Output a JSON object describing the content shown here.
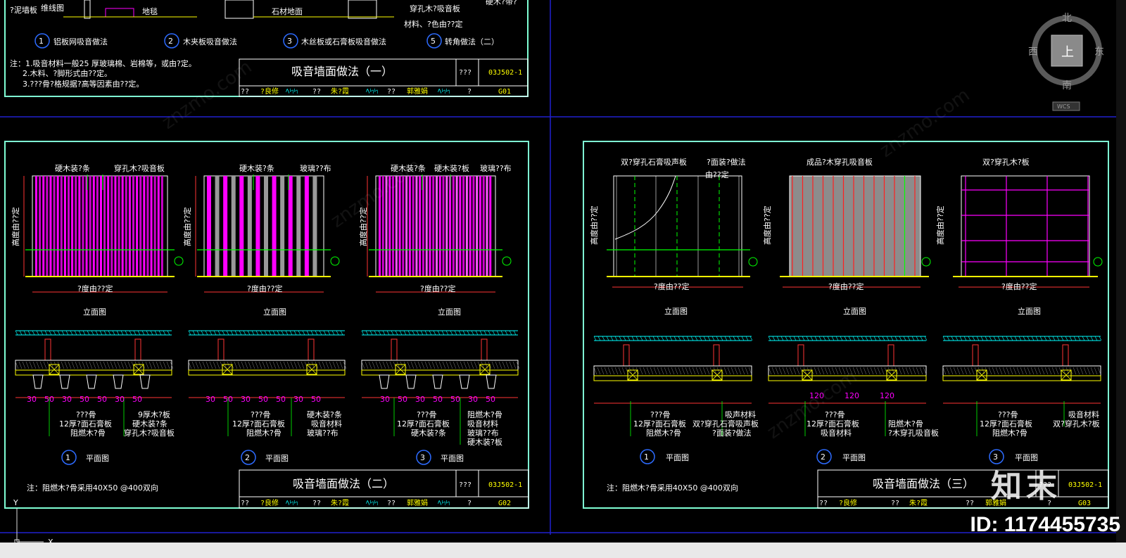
{
  "viewcube": {
    "north": "北",
    "south": "南",
    "west": "西",
    "east": "东",
    "top": "上",
    "wcs": "WCS"
  },
  "sheet1": {
    "top_labels": [
      "?泥墙板",
      "维线图",
      "地毯",
      "石材地面",
      "穿孔木?吸音板",
      "材料、?色由??定",
      "硬木?带?"
    ],
    "details": [
      {
        "num": "1",
        "label": "铝板网吸音做法"
      },
      {
        "num": "2",
        "label": "木夹板吸音做法"
      },
      {
        "num": "3",
        "label": "木丝板或石膏板吸音做法"
      },
      {
        "num": "5",
        "label": "转角做法（二）"
      }
    ],
    "notes": [
      "注：1.吸音材料一般25 厚玻璃棉、岩棉等，或由?定。",
      "2.木料、?脚形式由??定。",
      "3.???骨?格规据?高等因素由??定。"
    ],
    "title": "吸音墙面做法（一）",
    "code": "03J502-1",
    "sheet": "G01"
  },
  "titleblock_common": {
    "qqq": "???",
    "q2": "??",
    "designer": "?良修",
    "c1": "??",
    "checker": "朱?霞",
    "c2": "??",
    "reviewer": "郭雅娟",
    "q1": "?"
  },
  "sheet2": {
    "elevations": [
      {
        "labels": [
          "硬木装?条",
          "穿孔木?吸音板"
        ],
        "height": "高度由??定",
        "width": "?度由??定",
        "caption": "立面图"
      },
      {
        "labels": [
          "硬木装?条",
          "玻璃??布"
        ],
        "height": "高度由??定",
        "width": "?度由??定",
        "caption": "立面图"
      },
      {
        "labels": [
          "硬木装?条",
          "硬木装?板",
          "玻璃??布"
        ],
        "height": "高度由??定",
        "width": "?度由??定",
        "caption": "立面图"
      }
    ],
    "dim": [
      "30",
      "50",
      "30",
      "50",
      "50",
      "30",
      "50"
    ],
    "plans": [
      {
        "num": "1",
        "caption": "平面图",
        "left": [
          "???骨",
          "12厚?面石膏板",
          "阻燃木?骨"
        ],
        "right": [
          "9厚木?板",
          "硬木装?条",
          "穿孔木?吸音板"
        ]
      },
      {
        "num": "2",
        "caption": "平面图",
        "left": [
          "???骨",
          "12厚?面石膏板",
          "阻燃木?骨"
        ],
        "right": [
          "硬木装?条",
          "吸音材料",
          "玻璃??布"
        ]
      },
      {
        "num": "3",
        "caption": "平面图",
        "left": [
          "???骨",
          "12厚?面石膏板",
          "硬木装?条"
        ],
        "right": [
          "阻燃木?骨",
          "吸音材料",
          "玻璃??布",
          "硬木装?板"
        ]
      }
    ],
    "note": "注：阻燃木?骨采用40X50    @400双向",
    "title": "吸音墙面做法（二）",
    "code": "03J502-1",
    "sheet": "G02"
  },
  "sheet3": {
    "elevations": [
      {
        "labels": [
          "双?穿孔石膏吸声板",
          "?面装?做法",
          "由??定"
        ],
        "height": "高度由??定",
        "width": "?度由??定",
        "caption": "立面图"
      },
      {
        "labels": [
          "成品?木穿孔吸音板"
        ],
        "height": "高度由??定",
        "width": "?度由??定",
        "caption": "立面图"
      },
      {
        "labels": [
          "双?穿孔木?板"
        ],
        "height": "高度由??定",
        "width": "?度由??定",
        "caption": "立面图"
      }
    ],
    "dim": [
      "120",
      "120",
      "120"
    ],
    "plans": [
      {
        "num": "1",
        "caption": "平面图",
        "left": [
          "???骨",
          "12厚?面石膏板",
          "阻燃木?骨"
        ],
        "right": [
          "吸声材料",
          "双?穿孔石膏吸声板",
          "?面装?做法"
        ]
      },
      {
        "num": "2",
        "caption": "平面图",
        "left": [
          "???骨",
          "12厚?面石膏板",
          "吸音材料"
        ],
        "right": [
          "阻燃木?骨",
          "?木穿孔吸音板"
        ]
      },
      {
        "num": "3",
        "caption": "平面图",
        "left": [
          "???骨",
          "12厚?面石膏板",
          "阻燃木?骨"
        ],
        "right": [
          "吸音材料",
          "双?穿孔木?板"
        ]
      }
    ],
    "note": "注：阻燃木?骨采用40X50    @400双向",
    "title": "吸音墙面做法（三）",
    "code": "03J502-1",
    "sheet": "G03"
  },
  "watermark_text": "znzmo.com",
  "brand": "知末",
  "image_id": "ID: 1174455735",
  "ucs": {
    "x": "X",
    "y": "Y"
  }
}
